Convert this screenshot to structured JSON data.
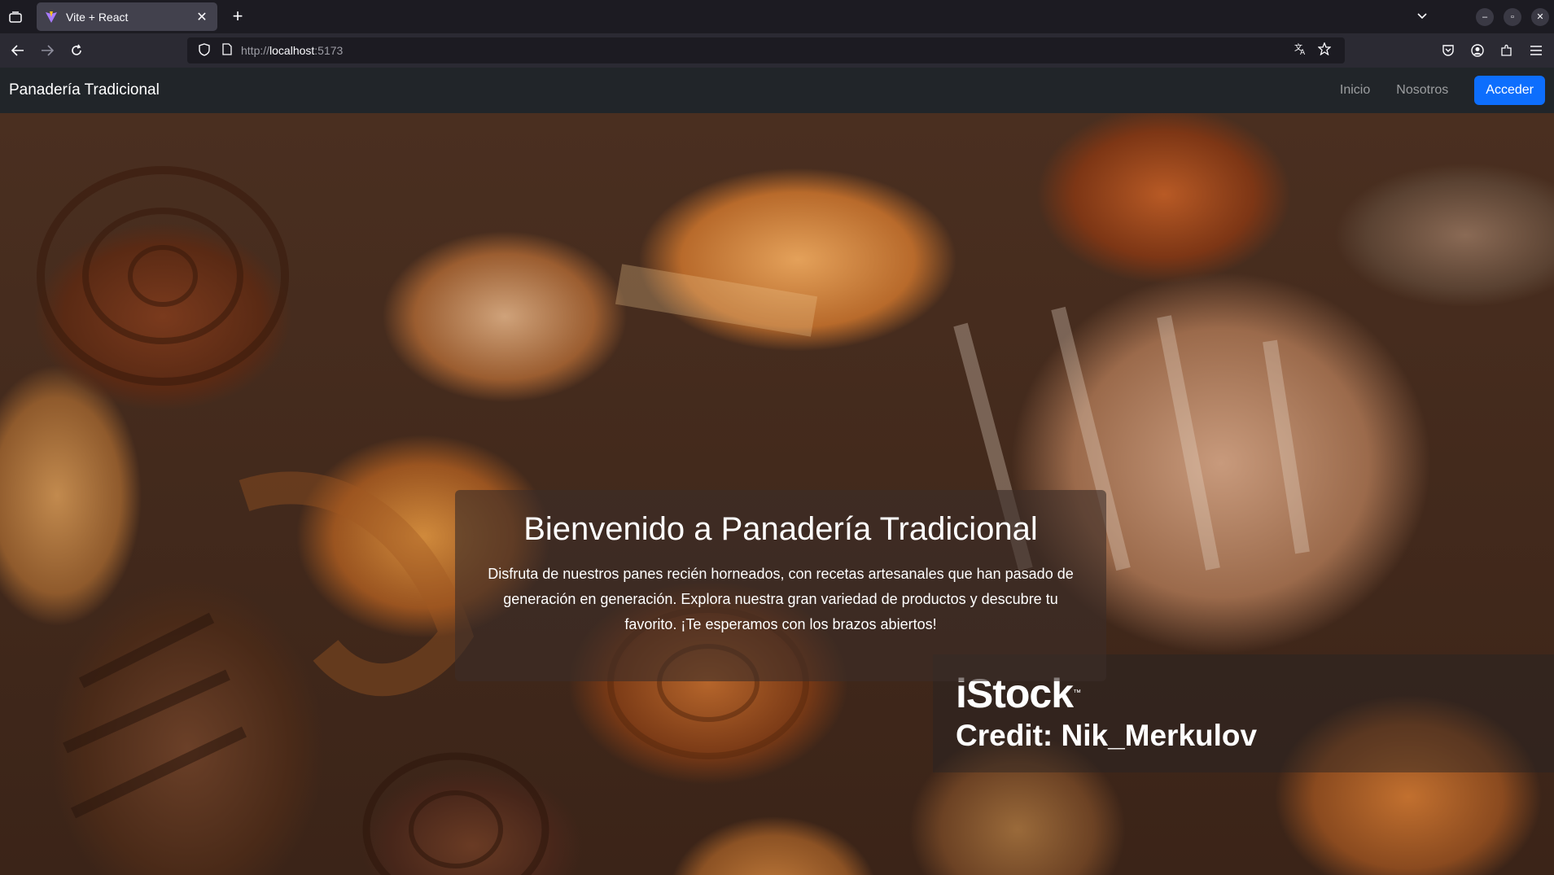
{
  "browser": {
    "tab_title": "Vite + React",
    "tab_close": "✕",
    "new_tab": "+",
    "url_scheme": "http://",
    "url_host": "localhost",
    "url_rest": ":5173"
  },
  "site": {
    "brand": "Panadería Tradicional",
    "nav_links": [
      "Inicio",
      "Nosotros"
    ],
    "login_label": "Acceder",
    "accent_color": "#0d6efd",
    "navbar_color": "#212529"
  },
  "hero": {
    "title": "Bienvenido a Panadería Tradicional",
    "text": "Disfruta de nuestros panes recién horneados, con recetas artesanales que han pasado de generación en generación. Explora nuestra gran variedad de productos y descubre tu favorito. ¡Te esperamos con los brazos abiertos!",
    "background": "bakery-breads-photo"
  },
  "watermark": {
    "logo": "iStock",
    "trademark": "™",
    "credit": "Credit: Nik_Merkulov"
  }
}
